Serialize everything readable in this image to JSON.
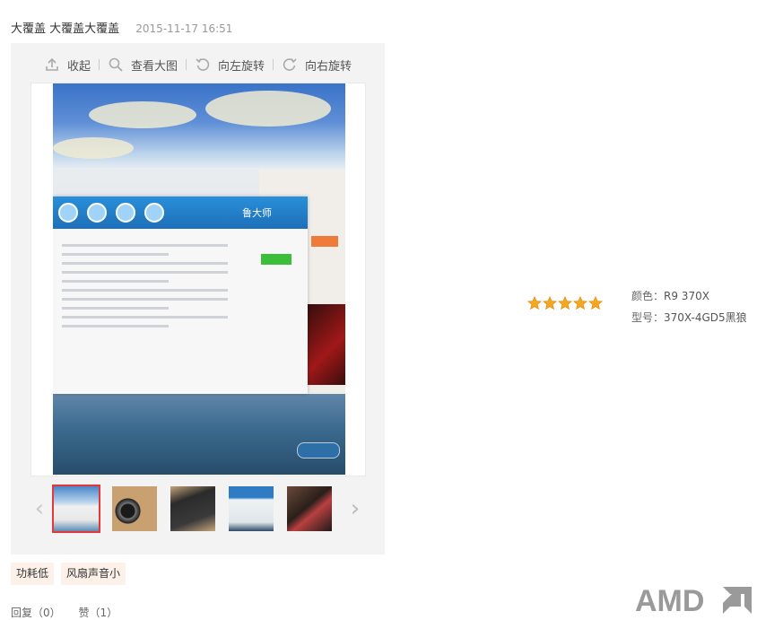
{
  "header": {
    "username": "大覆盖 大覆盖大覆盖",
    "date": "2015-11-17 16:51"
  },
  "toolbar": {
    "collapse": "收起",
    "view_large": "查看大图",
    "rotate_left": "向左旋转",
    "rotate_right": "向右旋转"
  },
  "main_image": {
    "app_brand": "鲁大师"
  },
  "thumbnails": {
    "count": 5,
    "active_index": 0
  },
  "tags": [
    "功耗低",
    "风扇声音小"
  ],
  "footer": {
    "reply": "回复（0）",
    "like": "赞（1）"
  },
  "rating": {
    "stars": 5,
    "max": 5,
    "color": "#f5a623"
  },
  "attributes": {
    "color_label": "颜色：",
    "color_value": "R9 370X",
    "model_label": "型号：",
    "model_value": "370X-4GD5黑狼"
  },
  "brand_logo": "AMD"
}
